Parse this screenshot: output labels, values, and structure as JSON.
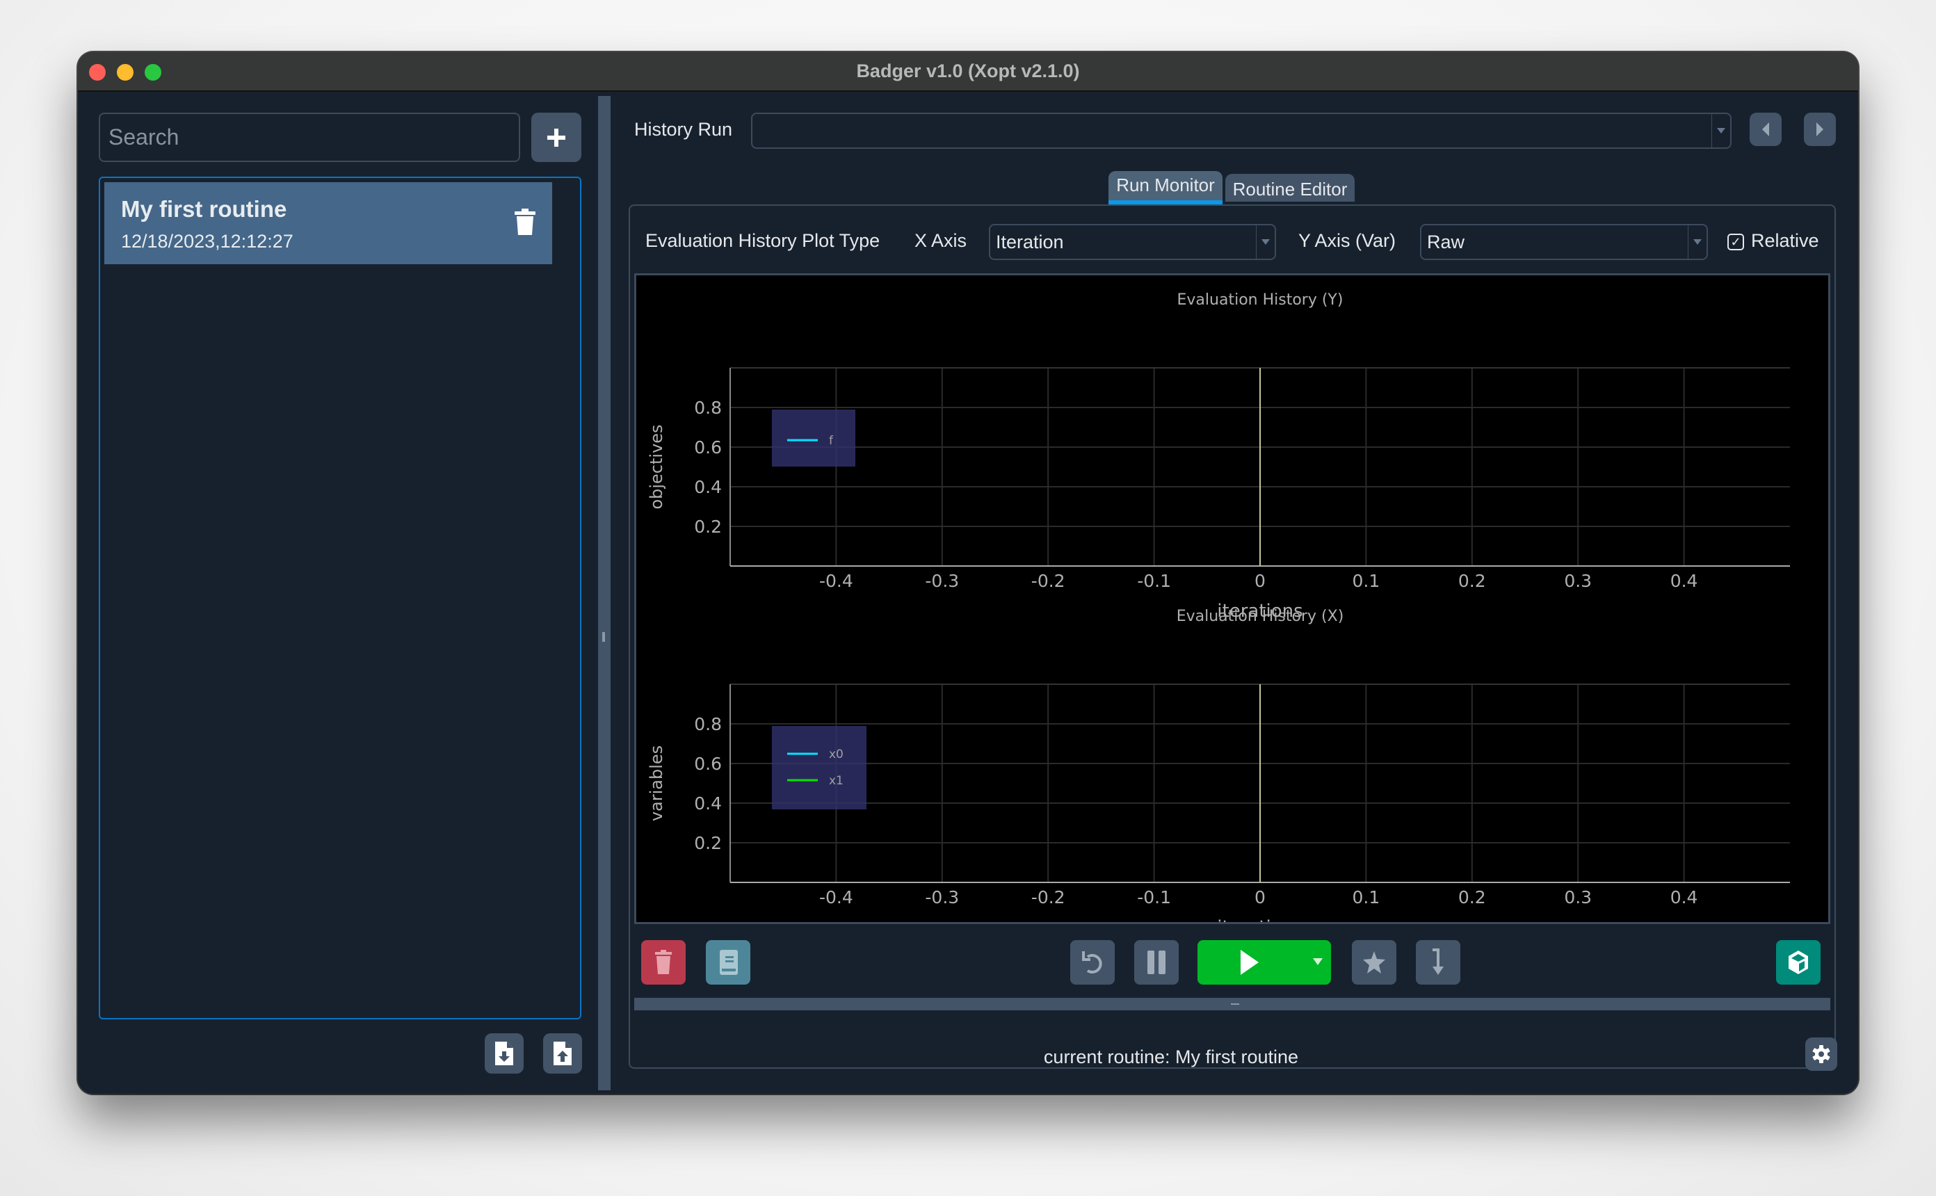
{
  "window": {
    "title": "Badger v1.0 (Xopt v2.1.0)",
    "traffic_lights": {
      "close": "#ff5f57",
      "minimize": "#febc2e",
      "zoom": "#28c840"
    }
  },
  "sidebar": {
    "search": {
      "placeholder": "Search",
      "value": ""
    },
    "add_button_icon": "plus-icon",
    "routines": [
      {
        "name": "My first routine",
        "timestamp": "12/18/2023,12:12:27",
        "selected": true,
        "delete_icon": "trash-icon"
      }
    ],
    "footer_buttons": [
      {
        "name": "export-routine",
        "icon": "file-download-icon"
      },
      {
        "name": "import-routine",
        "icon": "file-upload-icon"
      }
    ]
  },
  "main": {
    "history_run": {
      "label": "History Run",
      "value": ""
    },
    "nav_icons": {
      "prev": "caret-left-icon",
      "next": "caret-right-icon"
    },
    "tabs": [
      {
        "label": "Run Monitor",
        "active": true
      },
      {
        "label": "Routine Editor",
        "active": false
      }
    ],
    "plot_controls": {
      "plot_type_label": "Evaluation History Plot Type",
      "x_axis_label": "X Axis",
      "x_axis_value": "Iteration",
      "y_axis_label": "Y Axis (Var)",
      "y_axis_value": "Raw",
      "relative_label": "Relative",
      "relative_checked": true
    },
    "toolbar": {
      "left": [
        {
          "name": "delete-run",
          "icon": "trash-icon",
          "color": "#b93a4c"
        },
        {
          "name": "logbook",
          "icon": "book-icon",
          "color": "#4d8699"
        }
      ],
      "center": [
        {
          "name": "reset",
          "icon": "undo-icon",
          "color": "#435468"
        },
        {
          "name": "pause",
          "icon": "pause-icon",
          "color": "#435468"
        },
        {
          "name": "run",
          "icon": "play-icon",
          "color": "#00b926",
          "has_dropdown": true
        },
        {
          "name": "jump-to-optimum",
          "icon": "star-icon",
          "color": "#435468"
        },
        {
          "name": "dial-in",
          "icon": "arrow-down-step-icon",
          "color": "#435468"
        }
      ],
      "right": [
        {
          "name": "extensions",
          "icon": "cube-icon",
          "color": "#008b7b"
        }
      ]
    },
    "status": "current routine: My first routine",
    "settings_icon": "gear-icon"
  },
  "chart_data": [
    {
      "type": "line",
      "title": "Evaluation History (Y)",
      "xlabel": "iterations",
      "ylabel": "objectives",
      "xlim": [
        -0.5,
        0.5
      ],
      "ylim": [
        0,
        1
      ],
      "xticks": [
        -0.4,
        -0.3,
        -0.2,
        -0.1,
        0,
        0.1,
        0.2,
        0.3,
        0.4
      ],
      "xtick_labels": [
        "-0.4",
        "-0.3",
        "-0.2",
        "-0.1",
        "0",
        "0.1",
        "0.2",
        "0.3",
        "0.4"
      ],
      "yticks": [
        0.2,
        0.4,
        0.6,
        0.8
      ],
      "ytick_labels": [
        "0.2",
        "0.4",
        "0.6",
        "0.8"
      ],
      "grid": true,
      "legend": "top-left",
      "vertical_marker_x": 0,
      "series": [
        {
          "name": "f",
          "color": "#00e5ff",
          "x": [],
          "y": []
        }
      ]
    },
    {
      "type": "line",
      "title": "Evaluation History (X)",
      "xlabel": "iterations",
      "ylabel": "variables",
      "xlim": [
        -0.5,
        0.5
      ],
      "ylim": [
        0,
        1
      ],
      "xticks": [
        -0.4,
        -0.3,
        -0.2,
        -0.1,
        0,
        0.1,
        0.2,
        0.3,
        0.4
      ],
      "xtick_labels": [
        "-0.4",
        "-0.3",
        "-0.2",
        "-0.1",
        "0",
        "0.1",
        "0.2",
        "0.3",
        "0.4"
      ],
      "yticks": [
        0.2,
        0.4,
        0.6,
        0.8
      ],
      "ytick_labels": [
        "0.2",
        "0.4",
        "0.6",
        "0.8"
      ],
      "grid": true,
      "legend": "top-left",
      "vertical_marker_x": 0,
      "series": [
        {
          "name": "x0",
          "color": "#00e5ff",
          "x": [],
          "y": []
        },
        {
          "name": "x1",
          "color": "#00e600",
          "x": [],
          "y": []
        }
      ]
    }
  ]
}
